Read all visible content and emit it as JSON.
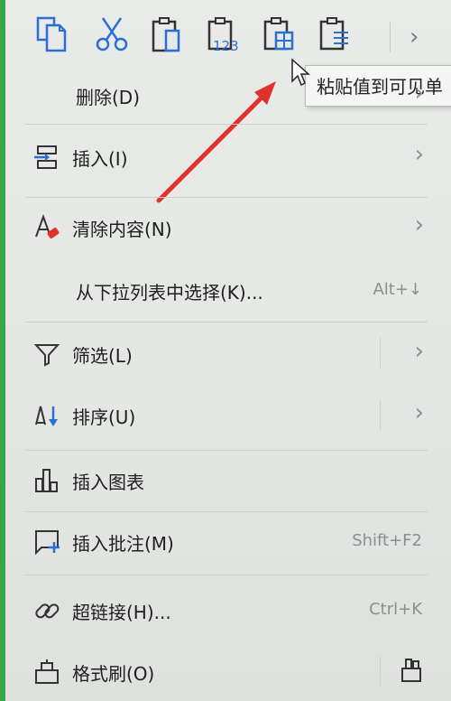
{
  "tooltip": "粘贴值到可见单",
  "menu": [
    {
      "label": "删除(D)",
      "icon": "none",
      "submenu": true
    },
    {
      "label": "插入(I)",
      "icon": "insert-icon",
      "submenu": true
    },
    {
      "label": "清除内容(N)",
      "icon": "clear-contents-icon",
      "submenu": true
    },
    {
      "label": "从下拉列表中选择(K)...",
      "icon": "none",
      "shortcut": "Alt+↓"
    },
    {
      "label": "筛选(L)",
      "icon": "filter-icon",
      "submenu": true
    },
    {
      "label": "排序(U)",
      "icon": "sort-icon",
      "submenu": true
    },
    {
      "label": "插入图表",
      "icon": "chart-icon"
    },
    {
      "label": "插入批注(M)",
      "icon": "comment-icon",
      "shortcut": "Shift+F2"
    },
    {
      "label": "超链接(H)...",
      "icon": "hyperlink-icon",
      "shortcut": "Ctrl+K"
    },
    {
      "label": "格式刷(O)",
      "icon": "format-painter-icon"
    }
  ],
  "toolbar": {
    "paste_values_text": "123",
    "more": "›"
  },
  "colors": {
    "accent_blue": "#2b6fd6",
    "arrow_red": "#e0322c",
    "menu_bg": "#e7e9e7"
  }
}
